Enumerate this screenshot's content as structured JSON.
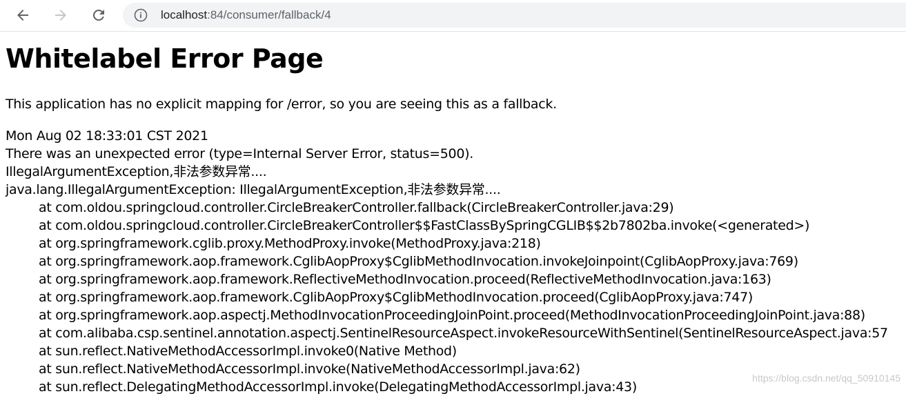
{
  "browser": {
    "url_host": "localhost",
    "url_path": ":84/consumer/fallback/4",
    "back_icon": "arrow-left",
    "forward_icon": "arrow-right",
    "reload_icon": "reload",
    "info_icon": "info-circle"
  },
  "page": {
    "title": "Whitelabel Error Page",
    "message": "This application has no explicit mapping for /error, so you are seeing this as a fallback.",
    "timestamp": "Mon Aug 02 18:33:01 CST 2021",
    "error_summary": "There was an unexpected error (type=Internal Server Error, status=500).",
    "exception_message": "IllegalArgumentException,非法参数异常....",
    "exception_class_line": "java.lang.IllegalArgumentException: IllegalArgumentException,非法参数异常....",
    "stack_trace": [
      "at com.oldou.springcloud.controller.CircleBreakerController.fallback(CircleBreakerController.java:29)",
      "at com.oldou.springcloud.controller.CircleBreakerController$$FastClassBySpringCGLIB$$2b7802ba.invoke(<generated>)",
      "at org.springframework.cglib.proxy.MethodProxy.invoke(MethodProxy.java:218)",
      "at org.springframework.aop.framework.CglibAopProxy$CglibMethodInvocation.invokeJoinpoint(CglibAopProxy.java:769)",
      "at org.springframework.aop.framework.ReflectiveMethodInvocation.proceed(ReflectiveMethodInvocation.java:163)",
      "at org.springframework.aop.framework.CglibAopProxy$CglibMethodInvocation.proceed(CglibAopProxy.java:747)",
      "at org.springframework.aop.aspectj.MethodInvocationProceedingJoinPoint.proceed(MethodInvocationProceedingJoinPoint.java:88)",
      "at com.alibaba.csp.sentinel.annotation.aspectj.SentinelResourceAspect.invokeResourceWithSentinel(SentinelResourceAspect.java:57",
      "at sun.reflect.NativeMethodAccessorImpl.invoke0(Native Method)",
      "at sun.reflect.NativeMethodAccessorImpl.invoke(NativeMethodAccessorImpl.java:62)",
      "at sun.reflect.DelegatingMethodAccessorImpl.invoke(DelegatingMethodAccessorImpl.java:43)"
    ]
  },
  "watermark": "https://blog.csdn.net/qq_50910145"
}
